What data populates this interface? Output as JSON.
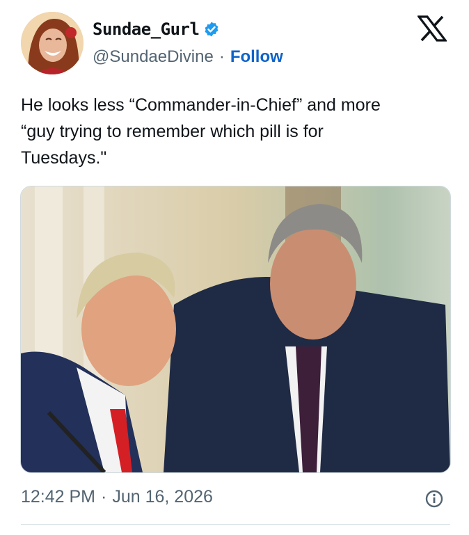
{
  "author": {
    "display_name": "Sundae_Gurl",
    "handle": "@SundaeDivine",
    "separator": "·",
    "follow_label": "Follow",
    "verified_icon": "verified-badge-icon",
    "verified_color": "#1d9bf0"
  },
  "brand": {
    "logo_icon": "x-logo-icon"
  },
  "tweet": {
    "text": "He looks less “Commander-in-Chief” and more\n“guy trying to remember which pill is for\nTuesdays.\""
  },
  "meta": {
    "time": "12:42 PM",
    "separator": "·",
    "date": "Jun 16, 2026",
    "info_icon": "info-icon"
  },
  "colors": {
    "link": "#0f63c9",
    "secondary_text": "#536471",
    "border": "#cfd9de"
  }
}
